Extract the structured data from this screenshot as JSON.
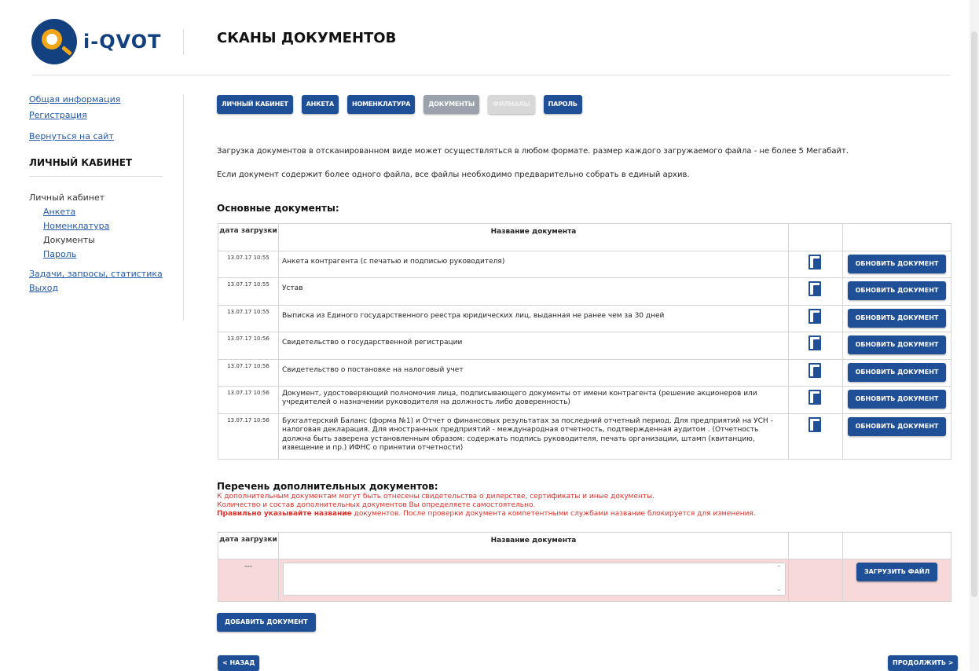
{
  "logo": {
    "text": "i-QVOT"
  },
  "page_title": "СКАНЫ ДОКУМЕНТОВ",
  "sidebar": {
    "general_info": "Общая информация",
    "registration": "Регистрация",
    "back_to_site": "Вернуться на сайт",
    "section_title": "ЛИЧНЫЙ КАБИНЕТ",
    "cabinet": "Личный кабинет",
    "items": [
      "Анкета",
      "Номенклатура",
      "Документы",
      "Пароль"
    ],
    "tasks": "Задачи, запросы, статистика",
    "logout": "Выход"
  },
  "tabs": [
    {
      "label": "ЛИЧНЫЙ КАБИНЕТ",
      "state": "normal"
    },
    {
      "label": "АНКЕТА",
      "state": "normal"
    },
    {
      "label": "НОМЕНКЛАТУРА",
      "state": "normal"
    },
    {
      "label": "ДОКУМЕНТЫ",
      "state": "active"
    },
    {
      "label": "ФИЛИАЛЫ",
      "state": "disabled"
    },
    {
      "label": "ПАРОЛЬ",
      "state": "normal"
    }
  ],
  "info": {
    "line1": "Загрузка документов в отсканированном виде может осуществляться в любом формате. размер каждого загружаемого файла - не более 5 Мегабайт.",
    "line2": "Если документ содержит более одного файла, все файлы необходимо предварительно собрать в единый архив."
  },
  "main_docs": {
    "title": "Основные документы:",
    "header_date": "дата загрузки",
    "header_name": "Название документа",
    "update_label": "ОБНОВИТЬ ДОКУМЕНТ",
    "rows": [
      {
        "date": "13.07.17 10:55",
        "name": "Анкета контрагента (с печатью и подписью руководителя)"
      },
      {
        "date": "13.07.17 10:55",
        "name": "Устав"
      },
      {
        "date": "13.07.17 10:55",
        "name": "Выписка из Единого государственного реестра юридических лиц, выданная не ранее чем за 30 дней"
      },
      {
        "date": "13.07.17 10:56",
        "name": "Свидетельство о государственной регистрации"
      },
      {
        "date": "13.07.17 10:56",
        "name": "Свидетельство о постановке на налоговый учет"
      },
      {
        "date": "13.07.17 10:56",
        "name": "Документ, удостоверяющий полномочия лица, подписывающего документы от имени контрагента (решение акционеров или учредителей о назначении руководителя на должность либо доверенность)"
      },
      {
        "date": "13.07.17 10:56",
        "name": "Бухгалтерский Баланс (форма №1) и Отчет о финансовых результатах за последний отчетный период. Для предприятий на УСН - налоговая декларация. Для иностранных предприятий - международная отчетность, подтвержденная аудитом . (Отчетность должна быть заверена установленным образом: содержать подпись руководителя, печать организации, штамп (квитанцию, извещение и пр.) ИФНС о принятии отчетности)"
      }
    ]
  },
  "extra_docs": {
    "title": "Перечень дополнительных документов:",
    "note1": "К дополнительным документам могут быть отнесены свидетельства о дилерстве, сертификаты и иные документы.",
    "note2": "Количество и состав дополнительных документов Вы определяете самостоятельно.",
    "note3_bold": "Правильно указывайте название",
    "note3_rest": " документов. После проверки документа компетентными службами название блокируется для изменения.",
    "header_date": "дата загрузки",
    "header_name": "Название документа",
    "row_date": "---",
    "upload_label": "ЗАГРУЗИТЬ ФАЙЛ"
  },
  "buttons": {
    "add_document": "ДОБАВИТЬ ДОКУМЕНТ",
    "back": "< НАЗАД",
    "next": "ПРОДОЛЖИТЬ >"
  }
}
